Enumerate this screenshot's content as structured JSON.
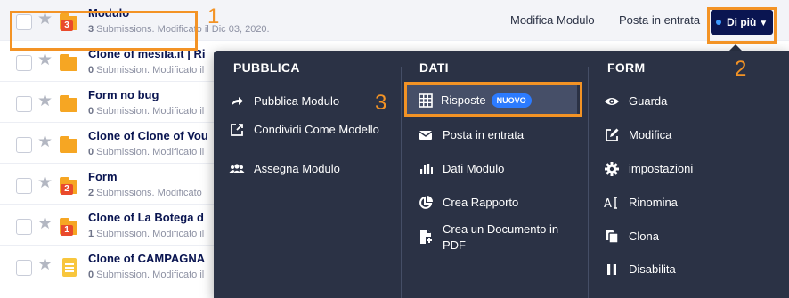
{
  "forms": [
    {
      "title": "Modulo",
      "count": "3",
      "subtitle": " Submissions. Modificato il Dic 03, 2020.",
      "badge": "3",
      "icon": "folder-form-icon"
    },
    {
      "title": "Clone of mesila.it | Ri",
      "count": "0",
      "subtitle": " Submission. Modificato il",
      "badge": "",
      "icon": "folder-form-icon"
    },
    {
      "title": "Form no bug",
      "count": "0",
      "subtitle": " Submission. Modificato il",
      "badge": "",
      "icon": "folder-form-icon"
    },
    {
      "title": "Clone of Clone of Vou",
      "count": "0",
      "subtitle": " Submission. Modificato il",
      "badge": "",
      "icon": "folder-form-icon"
    },
    {
      "title": "Form",
      "count": "2",
      "subtitle": " Submissions. Modificato",
      "badge": "2",
      "icon": "folder-form-icon"
    },
    {
      "title": "Clone of La Botega d",
      "count": "1",
      "subtitle": " Submission. Modificato il",
      "badge": "1",
      "icon": "folder-form-icon"
    },
    {
      "title": "Clone of CAMPAGNA",
      "count": "0",
      "subtitle": " Submission. Modificato il",
      "badge": "",
      "icon": "document-form-icon"
    }
  ],
  "row_actions": {
    "edit": "Modifica Modulo",
    "inbox": "Posta in entrata",
    "more": "Di più"
  },
  "menu": {
    "pubblica": {
      "heading": "PUBBLICA",
      "items": [
        {
          "label": "Pubblica Modulo",
          "icon": "share-arrow-icon"
        },
        {
          "label": "Condividi Come Modello",
          "icon": "share-box-icon"
        },
        {
          "label": "Assegna Modulo",
          "icon": "users-icon"
        }
      ]
    },
    "dati": {
      "heading": "DATI",
      "items": [
        {
          "label": "Risposte",
          "badge": "NUOVO",
          "icon": "table-grid-icon"
        },
        {
          "label": "Posta in entrata",
          "icon": "envelope-icon"
        },
        {
          "label": "Dati Modulo",
          "icon": "bar-chart-icon"
        },
        {
          "label": "Crea Rapporto",
          "icon": "report-pie-icon"
        },
        {
          "label": "Crea un Documento in PDF",
          "icon": "pdf-document-icon"
        }
      ]
    },
    "form": {
      "heading": "FORM",
      "items": [
        {
          "label": "Guarda",
          "icon": "eye-icon"
        },
        {
          "label": "Modifica",
          "icon": "pencil-icon"
        },
        {
          "label": "impostazioni",
          "icon": "gear-icon"
        },
        {
          "label": "Rinomina",
          "icon": "rename-text-icon"
        },
        {
          "label": "Clona",
          "icon": "copy-icon"
        },
        {
          "label": "Disabilita",
          "icon": "pause-icon"
        }
      ]
    }
  },
  "annotations": {
    "one": "1",
    "two": "2",
    "three": "3",
    "color": "#f39325"
  },
  "colors": {
    "menu_bg": "#2b3245",
    "title_text": "#0a1551",
    "new_badge": "#2c7bff",
    "folder": "#f6a623"
  }
}
